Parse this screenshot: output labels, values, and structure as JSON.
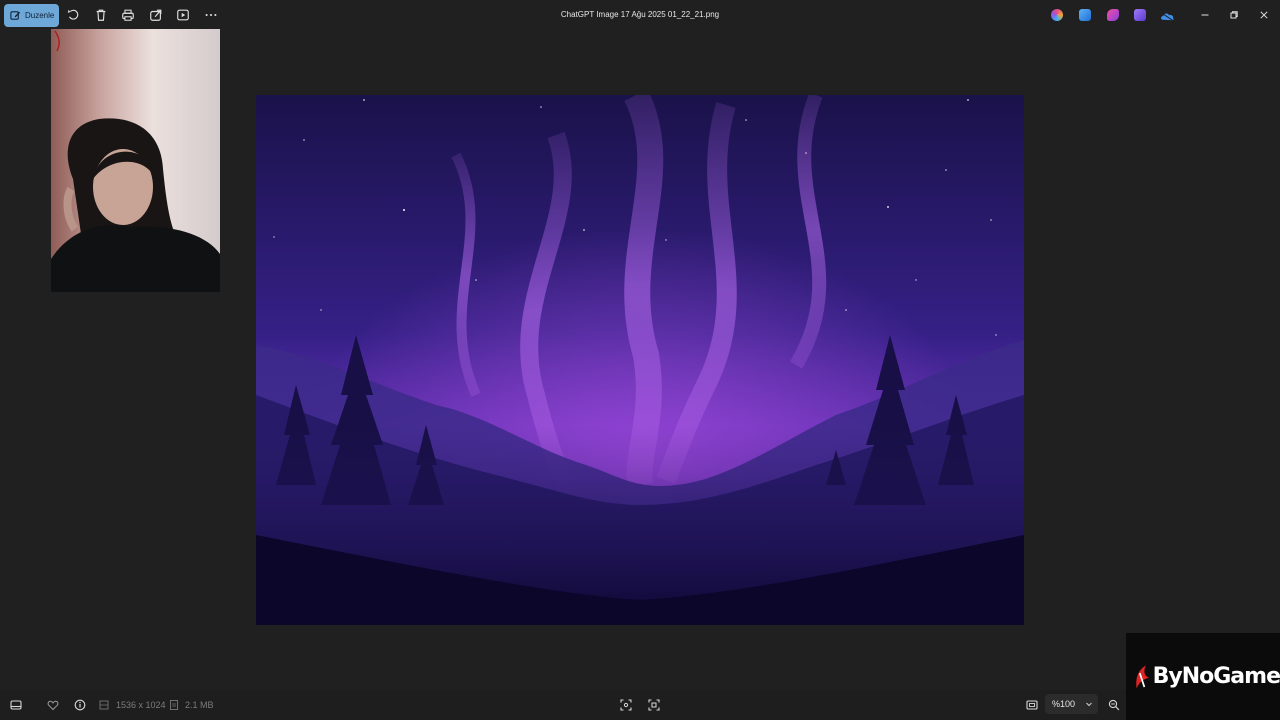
{
  "toolbar": {
    "edit_label": "Duzenle",
    "title": "ChatGPT Image 17 Ağu 2025 01_22_21.png",
    "tools": [
      "rotate-icon",
      "delete-icon",
      "print-icon",
      "share-icon",
      "slideshow-icon",
      "more-icon"
    ],
    "apps": [
      {
        "name": "copilot-icon",
        "color": "#e0588a"
      },
      {
        "name": "paint-icon",
        "color": "#3a8ee6"
      },
      {
        "name": "designer-icon",
        "color": "#c04ad8"
      },
      {
        "name": "clipchamp-icon",
        "color": "#7b4fe0"
      },
      {
        "name": "onedrive-icon",
        "color": "#3f8fe8"
      }
    ]
  },
  "status": {
    "dimensions": "1536 x 1024",
    "file_size": "2.1 MB",
    "zoom": "%100"
  },
  "watermark": {
    "brand": "ByNoGame"
  },
  "colors": {
    "accent": "#6ea8d8",
    "background": "#202020",
    "sky_top": "#1d1350",
    "aurora": "#8e3fd6"
  }
}
